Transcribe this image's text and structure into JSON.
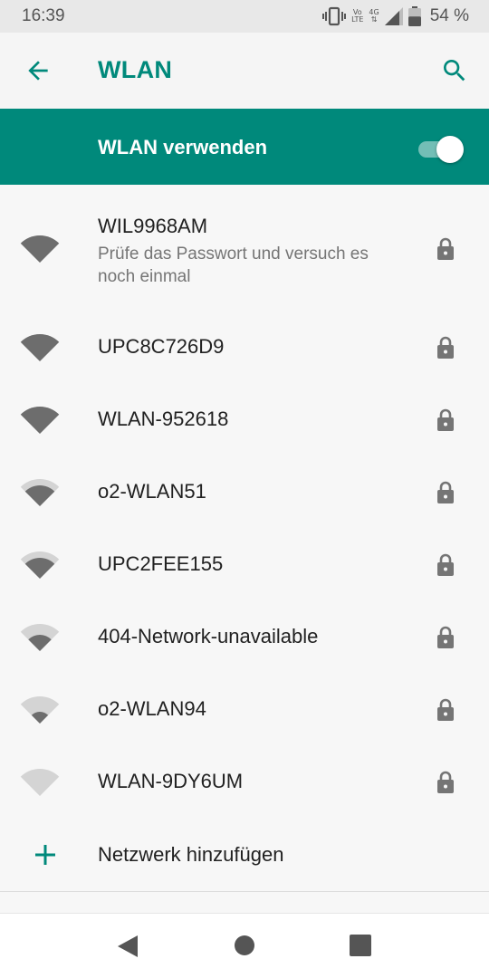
{
  "status_bar": {
    "time": "16:39",
    "icons": [
      "vibrate-icon",
      "volte-icon",
      "4g-icon",
      "signal-icon",
      "battery-icon"
    ],
    "volte_top": "Vo",
    "volte_bottom": "LTE",
    "network_top": "4G",
    "network_bottom": "⇅",
    "battery_percent": "54 %",
    "battery_level": 0.54
  },
  "app_bar": {
    "title": "WLAN",
    "back_icon": "arrow-back-icon",
    "search_icon": "search-icon",
    "accent_color": "#00897b"
  },
  "master_switch": {
    "label": "WLAN verwenden",
    "on": true,
    "background": "#00897b"
  },
  "networks": [
    {
      "name": "WIL9968AM",
      "status": "Prüfe das Passwort und versuch es noch einmal",
      "signal": 4,
      "secured": true
    },
    {
      "name": "UPC8C726D9",
      "signal": 4,
      "secured": true
    },
    {
      "name": "WLAN-952618",
      "signal": 4,
      "secured": true
    },
    {
      "name": "o2-WLAN51",
      "signal": 3,
      "secured": true
    },
    {
      "name": "UPC2FEE155",
      "signal": 3,
      "secured": true
    },
    {
      "name": "404-Network-unavailable",
      "signal": 2,
      "secured": true
    },
    {
      "name": "o2-WLAN94",
      "signal": 1,
      "secured": true
    },
    {
      "name": "WLAN-9DY6UM",
      "signal": 0,
      "secured": true
    }
  ],
  "add_network": {
    "label": "Netzwerk hinzufügen",
    "icon": "plus-icon"
  },
  "nav_bar": {
    "icons": [
      "nav-back-icon",
      "nav-home-icon",
      "nav-recents-icon"
    ]
  }
}
